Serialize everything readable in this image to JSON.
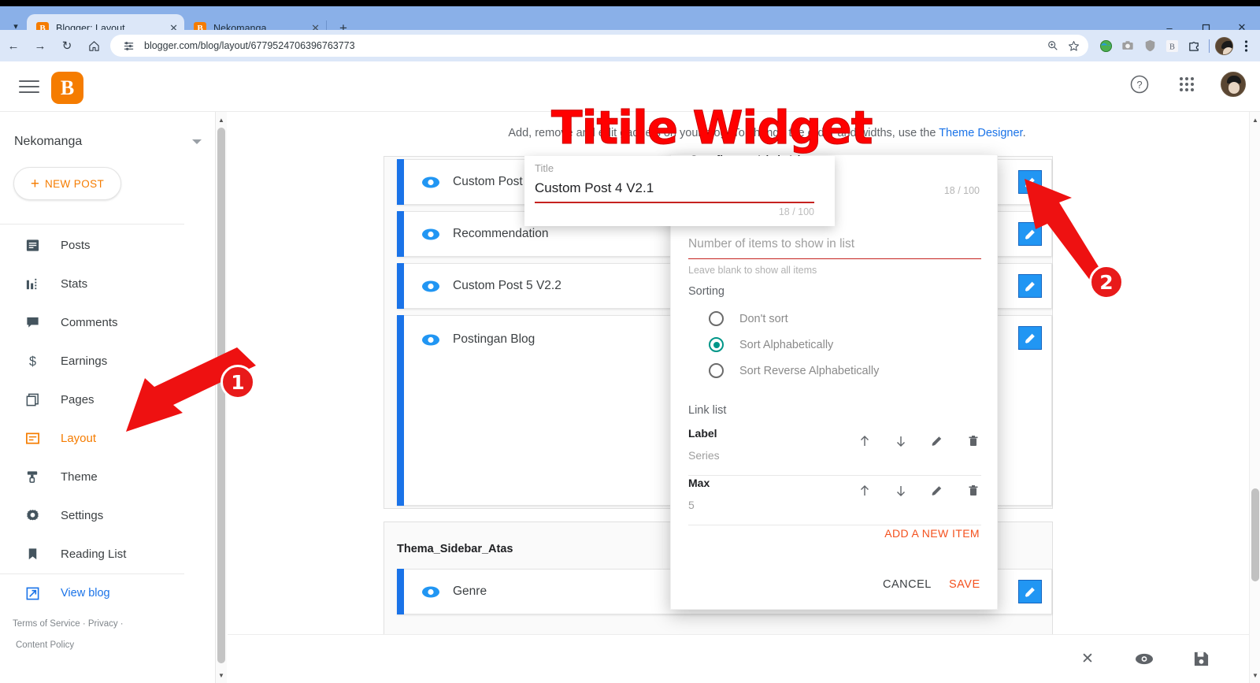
{
  "browser": {
    "tabs": [
      {
        "title": "Blogger: Layout",
        "favicon": "B",
        "active": true
      },
      {
        "title": "Nekomanga",
        "favicon": "B",
        "active": false
      }
    ],
    "new_tab_label": "+",
    "tab_close_label": "✕",
    "window_controls": {
      "minimize": "–",
      "maximize": "❐",
      "close": "✕"
    },
    "nav": {
      "back": "←",
      "forward": "→",
      "reload": "↻",
      "home": "⌂"
    },
    "url": "blogger.com/blog/layout/6779524706396763773",
    "omnibox_lead_icon": "page-settings-icon",
    "omnibox_actions": [
      "zoom-icon",
      "bookmark-star-icon"
    ],
    "extensions": [
      "earth-icon",
      "camera-icon",
      "shield-icon",
      "blogger-ext-icon",
      "puzzle-icon",
      "profile-icon",
      "kebab-menu-icon"
    ]
  },
  "header": {
    "menu_icon": "hamburger-icon",
    "logo_letter": "B",
    "help_icon": "?",
    "apps_icon": "apps-grid-icon",
    "avatar_icon": "user-avatar"
  },
  "sidebar": {
    "blog_name": "Nekomanga",
    "new_post_label": "NEW POST",
    "new_post_plus": "+",
    "items": [
      {
        "label": "Posts",
        "icon": "posts-icon",
        "active": false
      },
      {
        "label": "Stats",
        "icon": "stats-icon",
        "active": false
      },
      {
        "label": "Comments",
        "icon": "comments-icon",
        "active": false
      },
      {
        "label": "Earnings",
        "icon": "earnings-icon",
        "active": false
      },
      {
        "label": "Pages",
        "icon": "pages-icon",
        "active": false
      },
      {
        "label": "Layout",
        "icon": "layout-icon",
        "active": true
      },
      {
        "label": "Theme",
        "icon": "theme-icon",
        "active": false
      },
      {
        "label": "Settings",
        "icon": "settings-gear-icon",
        "active": false
      },
      {
        "label": "Reading List",
        "icon": "bookmark-icon",
        "active": false
      }
    ],
    "view_blog": {
      "label": "View blog",
      "icon": "external-link-icon"
    },
    "legal": {
      "terms": "Terms of Service",
      "dot1": "·",
      "privacy": "Privacy",
      "dot2": "·",
      "content_policy": "Content Policy"
    }
  },
  "main": {
    "subtitle_before": "Add, remove and edit gadgets on your blog. To change the order and widths, use the ",
    "subtitle_link": "Theme Designer",
    "subtitle_after": ".",
    "sections": [
      {
        "title": "",
        "gadgets": [
          {
            "label": "Custom Post 4 V2.1",
            "eye": "visible-eye-icon",
            "edit": "pencil-icon"
          },
          {
            "label": "Recommendation",
            "eye": "visible-eye-icon",
            "edit": "pencil-icon"
          },
          {
            "label": "Custom Post 5 V2.2",
            "eye": "visible-eye-icon",
            "edit": "pencil-icon"
          },
          {
            "label": "Postingan Blog",
            "eye": "visible-eye-icon",
            "edit": "pencil-icon"
          }
        ]
      },
      {
        "title": "Thema_Sidebar_Atas",
        "gadgets": [
          {
            "label": "Genre",
            "eye": "visible-eye-icon",
            "edit": "pencil-icon"
          }
        ]
      }
    ]
  },
  "dialog": {
    "title": "Configure Link List",
    "title_counter": "18 / 100",
    "num_items_placeholder": "Number of items to show in list",
    "num_items_help": "Leave blank to show all items",
    "sorting_label": "Sorting",
    "sorting_options": [
      {
        "label": "Don't sort",
        "selected": false
      },
      {
        "label": "Sort Alphabetically",
        "selected": true
      },
      {
        "label": "Sort Reverse Alphabetically",
        "selected": false
      }
    ],
    "link_list_label": "Link list",
    "link_items": [
      {
        "name": "Label",
        "value": "Series"
      },
      {
        "name": "Max",
        "value": "5"
      }
    ],
    "row_actions": [
      "move-up-icon",
      "move-down-icon",
      "edit-pencil-icon",
      "delete-trash-icon"
    ],
    "add_new_label": "ADD A NEW ITEM",
    "cancel_label": "CANCEL",
    "save_label": "SAVE"
  },
  "title_popup": {
    "label": "Title",
    "value": "Custom Post 4 V2.1",
    "counter": "18 / 100"
  },
  "bottom_bar": {
    "close_icon": "✕",
    "preview_icon": "preview-eye-icon",
    "save_icon": "save-disk-icon"
  },
  "annotations": {
    "overlay_text": "Titile Widget",
    "badges": [
      "1",
      "2"
    ],
    "accent_red": "#ff0000"
  },
  "colors": {
    "blogger_orange": "#f57c00",
    "link_blue": "#1a73e8",
    "gadget_blue": "#1a73e8",
    "edit_button_blue": "#2196f3",
    "radio_teal": "#009688",
    "action_orange": "#f4511e",
    "material_red_underline": "#c5221f"
  }
}
